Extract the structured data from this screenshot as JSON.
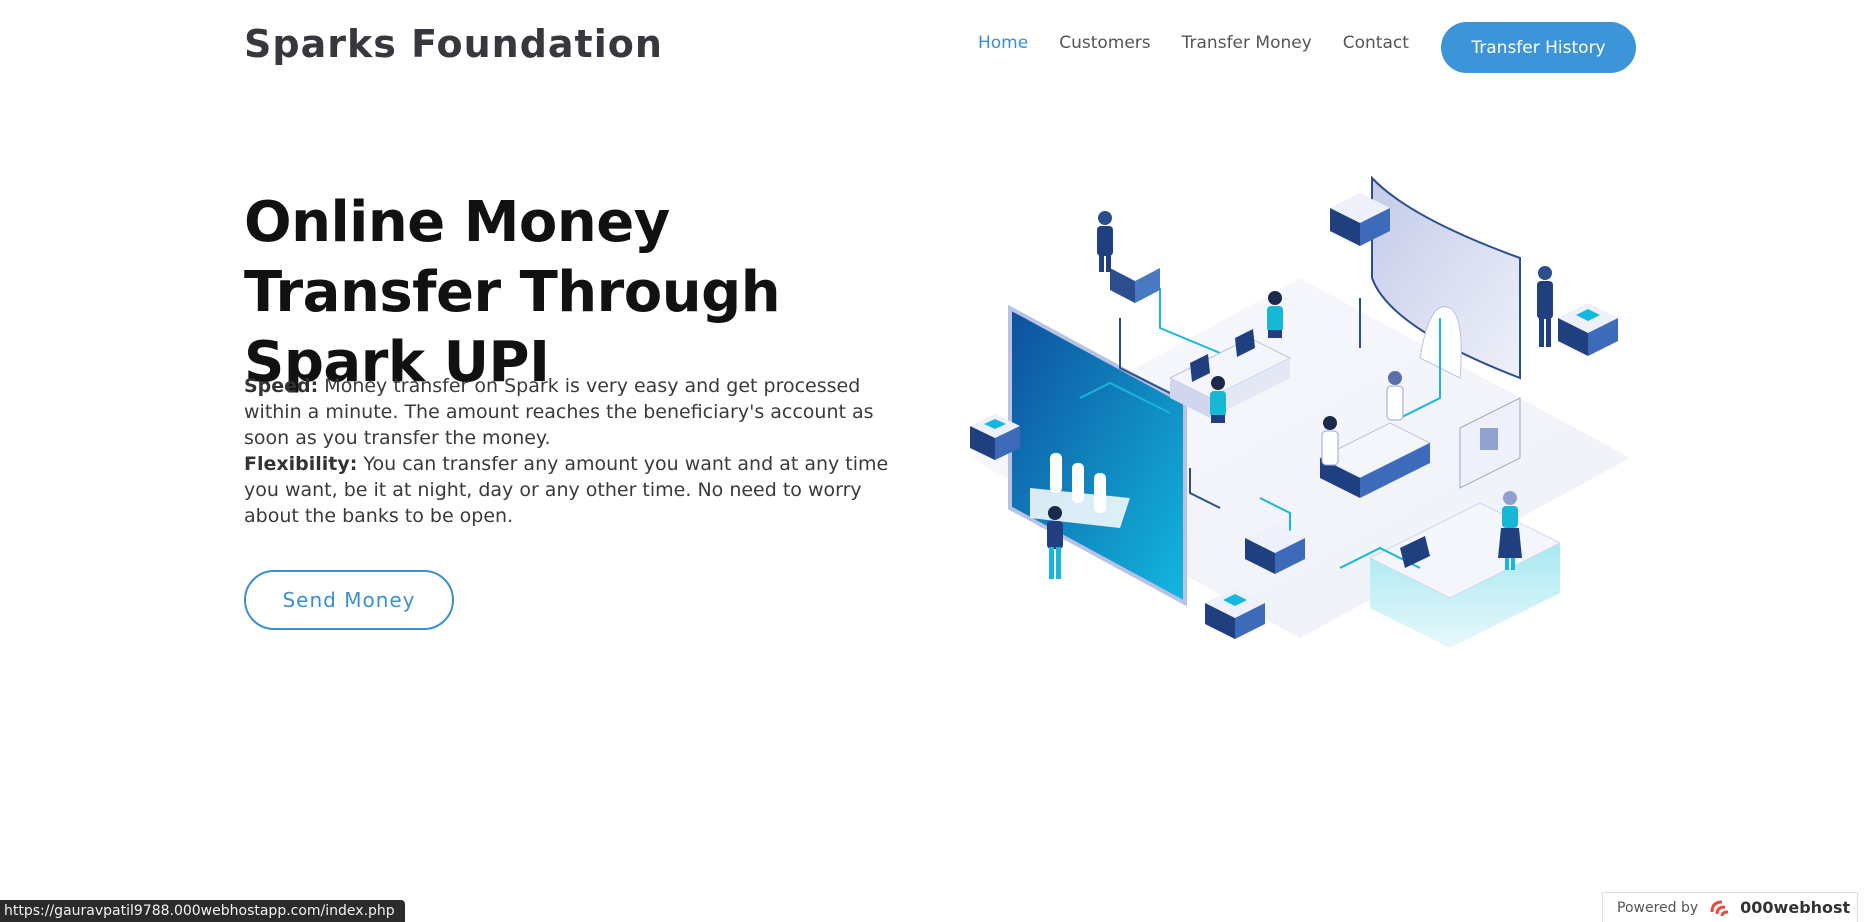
{
  "header": {
    "brand": "Sparks Foundation",
    "nav": [
      "Home",
      "Customers",
      "Transfer Money",
      "Contact"
    ],
    "history_button": "Transfer History"
  },
  "hero": {
    "title": "Online Money Transfer Through Spark UPI",
    "speed_label": "Speed:",
    "speed_text": " Money transfer on Spark is very easy and get processed within a minute. The amount reaches the beneficiary's account as soon as you transfer the money.",
    "flex_label": "Flexibility:",
    "flex_text": " You can transfer any amount you want and at any time you want, be it at night, day or any other time. No need to worry about the banks to be open.",
    "send_button": "Send Money"
  },
  "status": {
    "url": "https://gauravpatil9788.000webhostapp.com/index.php"
  },
  "footer_badge": {
    "powered_by": "Powered by",
    "host": "000webhost"
  },
  "colors": {
    "accent": "#3d95d9",
    "link_active": "#3a8fd0"
  }
}
